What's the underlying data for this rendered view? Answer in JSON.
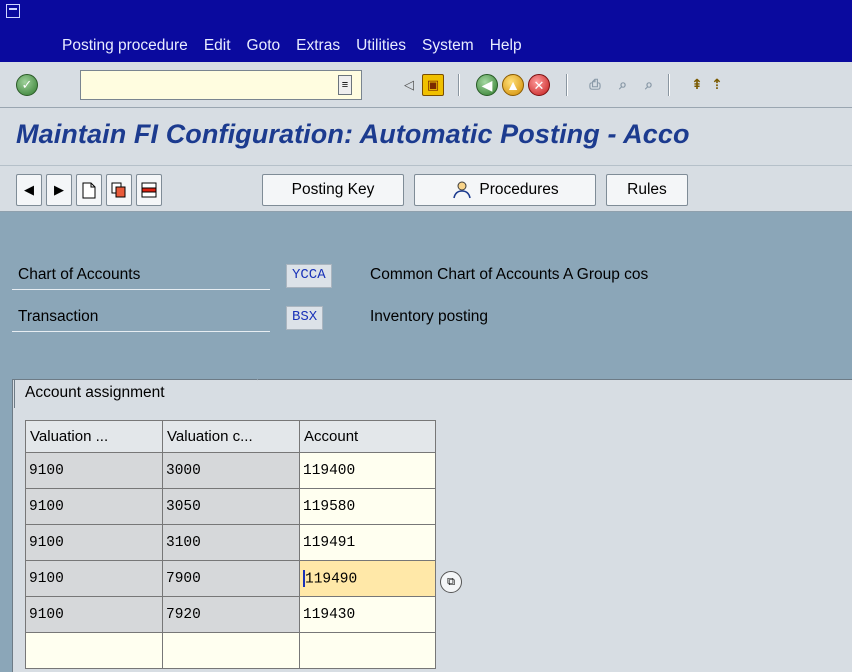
{
  "menu": [
    "Posting procedure",
    "Edit",
    "Goto",
    "Extras",
    "Utilities",
    "System",
    "Help"
  ],
  "toolbar": {
    "command_value": "",
    "icons": [
      "enter-icon",
      "save-icon",
      "back-icon",
      "exit-icon",
      "cancel-icon",
      "print-icon",
      "find-icon",
      "find-next-icon",
      "first-page-icon"
    ]
  },
  "title": "Maintain FI Configuration: Automatic Posting - Acco",
  "app_toolbar": {
    "posting_key": "Posting Key",
    "procedures": "Procedures",
    "rules": "Rules"
  },
  "header": {
    "chart_label": "Chart of Accounts",
    "chart_value": "YCCA",
    "chart_desc": "Common Chart of Accounts A Group cos",
    "transaction_label": "Transaction",
    "transaction_value": "BSX",
    "transaction_desc": "Inventory posting"
  },
  "tab": {
    "label": "Account assignment"
  },
  "table": {
    "columns": [
      "Valuation ...",
      "Valuation c...",
      "Account"
    ],
    "rows": [
      [
        "9100",
        "3000",
        "119400"
      ],
      [
        "9100",
        "3050",
        "119580"
      ],
      [
        "9100",
        "3100",
        "119491"
      ],
      [
        "9100",
        "7900",
        "119490"
      ],
      [
        "9100",
        "7920",
        "119430"
      ],
      [
        "",
        "",
        ""
      ]
    ]
  },
  "colors": {
    "menu_bg": "#0a0a9e",
    "title": "#1c3b8f",
    "header_area": "#8ba6b8",
    "key_value": "#1932b8"
  }
}
